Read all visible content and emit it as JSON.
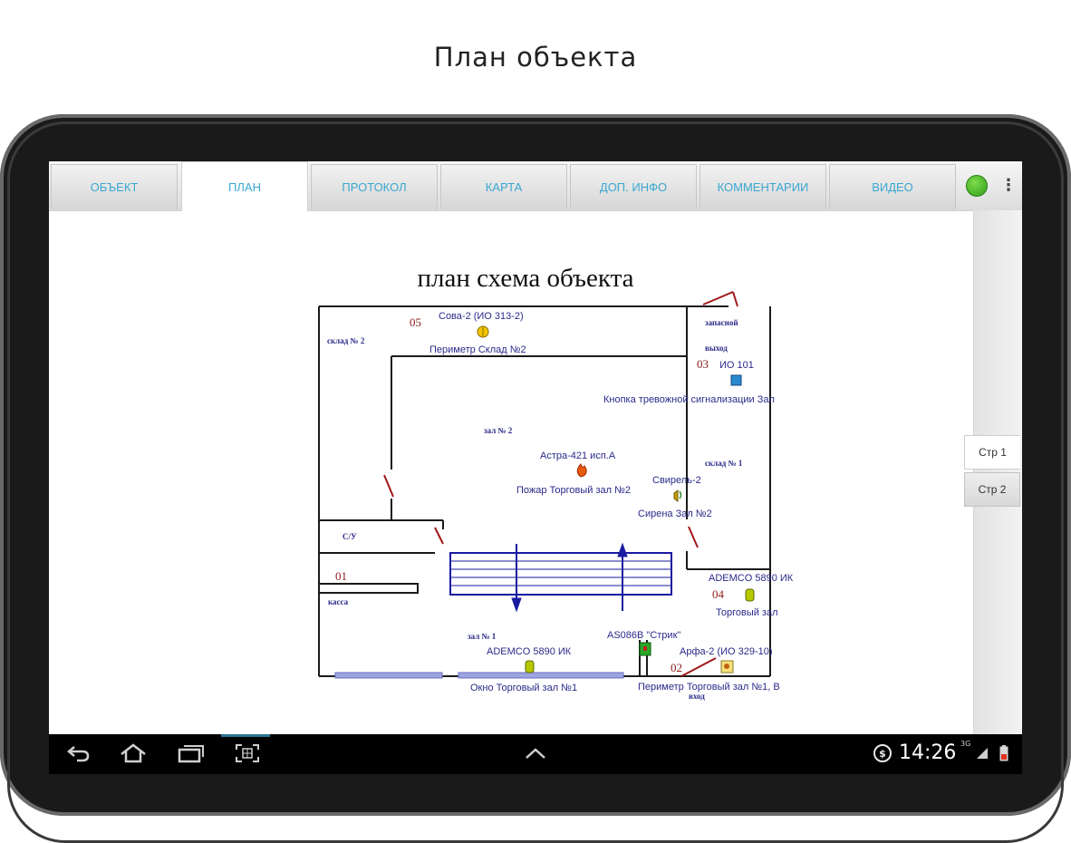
{
  "caption": "План объекта",
  "tabs": [
    {
      "label": "ОБЪЕКТ"
    },
    {
      "label": "ПЛАН"
    },
    {
      "label": "ПРОТОКОЛ"
    },
    {
      "label": "КАРТА"
    },
    {
      "label": "ДОП. ИНФО"
    },
    {
      "label": "КОММЕНТАРИИ"
    },
    {
      "label": "ВИДЕО"
    }
  ],
  "active_tab": "ПЛАН",
  "status_color": "#3cb82a",
  "pages": [
    {
      "label": "Стр 1"
    },
    {
      "label": "Стр 2"
    }
  ],
  "active_page": "Стр 1",
  "plan": {
    "title": "план схема объекта",
    "rooms": {
      "sklad2": "склад № 2",
      "zal2": "зал № 2",
      "su": "С/У",
      "kassa": "касса",
      "zal1": "зал № 1",
      "zapasnoy": "запасной",
      "vyhod": "выход",
      "sklad1": "склад № 1",
      "vhod": "вход"
    },
    "zones": {
      "z05": "05",
      "z03": "03",
      "z01": "01",
      "z04": "04",
      "z02": "02"
    },
    "sensors": {
      "sova": "Сова-2 (ИО 313-2)",
      "perimeter_sklad2": "Периметр Склад №2",
      "io101": "ИО 101",
      "knopka": "Кнопка тревожной сигнализации Зал",
      "astra": "Астра-421 исп.А",
      "pozhar": "Пожар Торговый зал №2",
      "svirel": "Свирель-2",
      "sirena": "Сирена Зал №2",
      "ademco_right": "ADEMCO 5890 ИК",
      "torgovy_zal": "Торговый зал",
      "as": "AS086B \"Стрик\"",
      "ademco_bottom": "ADEMCO 5890 ИК",
      "okno": "Окно Торговый зал №1",
      "arfa": "Арфа-2 (ИО 329-10)",
      "perimeter_zal1": "Периметр Торговый зал №1, В"
    }
  },
  "navbar": {
    "time": "14:26",
    "network": "3G"
  },
  "colors": {
    "accent": "#3aa7cf",
    "plan_line": "#1a1a1a",
    "label_blue": "#2a2a8a",
    "zone_red": "#8b1a1a",
    "door_red": "#a01818",
    "counter_blue": "#1a1aa0"
  }
}
